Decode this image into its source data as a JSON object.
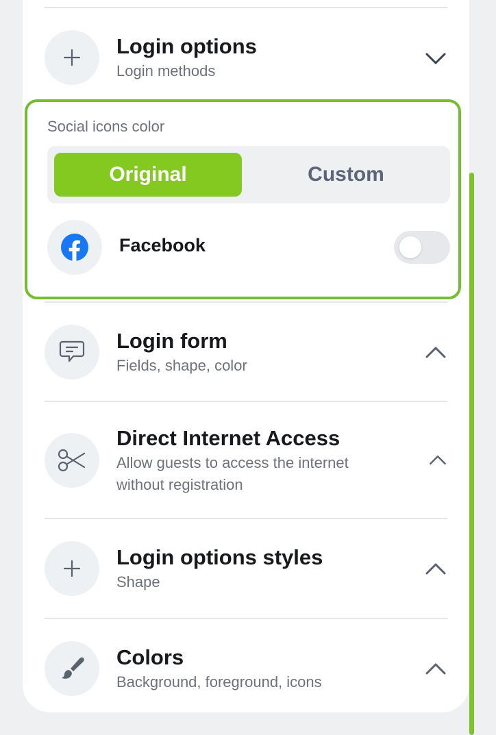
{
  "sections": {
    "login_options": {
      "title": "Login options",
      "subtitle": "Login methods",
      "icon": "plus-icon",
      "state": "expanded"
    },
    "social_colors": {
      "label": "Social icons color",
      "options": [
        "Original",
        "Custom"
      ],
      "selected": "Original",
      "facebook": {
        "label": "Facebook",
        "icon": "facebook-icon",
        "enabled": false
      }
    },
    "login_form": {
      "title": "Login form",
      "subtitle": "Fields, shape, color",
      "icon": "message-icon",
      "state": "collapsed"
    },
    "direct_access": {
      "title": "Direct Internet Access",
      "subtitle_line1": "Allow guests to access the internet",
      "subtitle_line2": "without registration",
      "icon": "scissors-icon",
      "state": "collapsed"
    },
    "options_styles": {
      "title": "Login options styles",
      "subtitle": "Shape",
      "icon": "plus-icon",
      "state": "collapsed"
    },
    "colors": {
      "title": "Colors",
      "subtitle": "Background, foreground, icons",
      "icon": "brush-icon",
      "state": "collapsed"
    }
  },
  "colors": {
    "accent": "#84c920",
    "highlight_border": "#77bc30",
    "facebook": "#1877f2"
  }
}
